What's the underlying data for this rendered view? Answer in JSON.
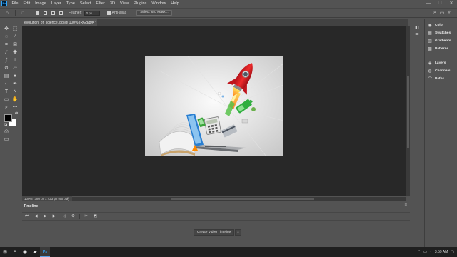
{
  "app": {
    "logo_text": "Ps",
    "menu": [
      "File",
      "Edit",
      "Image",
      "Layer",
      "Type",
      "Select",
      "Filter",
      "3D",
      "View",
      "Plugins",
      "Window",
      "Help"
    ],
    "window_controls": {
      "minimize": "—",
      "maximize": "☐",
      "close": "✕"
    }
  },
  "options_bar": {
    "feather_label": "Feather:",
    "feather_value": "0 px",
    "anti_alias_label": "Anti-alias",
    "select_mask_label": "Select and Mask..."
  },
  "document": {
    "tab_title": "evolution_of_science.jpg @ 100% (RGB/8#) *",
    "close_glyph": "×"
  },
  "status": {
    "zoom": "100%",
    "doc_info": "380 px x 423 px (96 ppi)",
    "arrow": ">"
  },
  "timeline": {
    "title": "Timeline",
    "create_button": "Create Video Timeline",
    "dropdown_glyph": "⌄"
  },
  "panels": {
    "group1": [
      {
        "label": "Color",
        "icon": "color-wheel-icon"
      },
      {
        "label": "Swatches",
        "icon": "swatches-icon"
      },
      {
        "label": "Gradients",
        "icon": "gradient-icon"
      },
      {
        "label": "Patterns",
        "icon": "pattern-icon"
      }
    ],
    "group2": [
      {
        "label": "Layers",
        "icon": "layers-icon"
      },
      {
        "label": "Channels",
        "icon": "channels-icon"
      },
      {
        "label": "Paths",
        "icon": "paths-icon"
      }
    ]
  },
  "colors": {
    "foreground": "#000000",
    "background": "#ffffff",
    "accent": "#31a8ff"
  },
  "taskbar": {
    "time": "3:59 AM"
  }
}
